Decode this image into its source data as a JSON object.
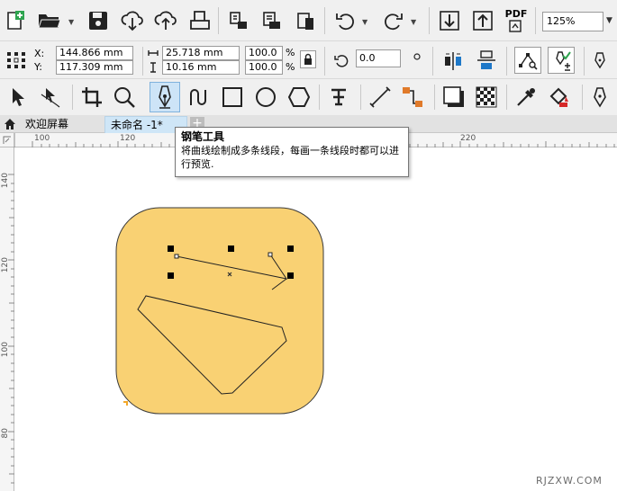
{
  "zoom": {
    "value": "125%"
  },
  "position": {
    "x_label": "X:",
    "y_label": "Y:",
    "x_value": "144.866 mm",
    "y_value": "117.309 mm"
  },
  "size": {
    "width_value": "25.718 mm",
    "height_value": "10.16 mm",
    "scale_x": "100.0",
    "scale_y": "100.0",
    "percent": "%"
  },
  "rotation": {
    "value": "0.0"
  },
  "pdf_label": "PDF",
  "tabs": {
    "welcome": "欢迎屏幕",
    "document": "未命名 -1*",
    "add": "+"
  },
  "ruler_h": {
    "labels": [
      "100",
      "120",
      "220"
    ]
  },
  "ruler_v": {
    "labels": [
      "140",
      "120",
      "100",
      "80"
    ]
  },
  "tooltip": {
    "title": "钢笔工具",
    "description": "将曲线绘制成多条线段，每画一条线段时都可以进行预览."
  },
  "colors": {
    "shape_fill": "#F9D173",
    "accent_blue": "#1e78c8",
    "pen_active_bg": "#cde4f7",
    "tab_active": "#cfe6f7",
    "new_doc_green": "#2ea44f"
  },
  "icons": [
    "new-document-icon",
    "open-folder-icon",
    "save-icon",
    "download-cloud-icon",
    "upload-cloud-icon",
    "print-icon",
    "import-icon",
    "export-icon",
    "clipboard-icon",
    "undo-icon",
    "redo-icon",
    "align-bottom-icon",
    "align-top-icon",
    "pdf-icon",
    "pick-tool-icon",
    "shape-tool-icon",
    "crop-tool-icon",
    "zoom-tool-icon",
    "pen-tool-icon",
    "freehand-tool-icon",
    "rectangle-tool-icon",
    "ellipse-tool-icon",
    "polygon-tool-icon",
    "text-tool-icon",
    "line-tool-icon",
    "connector-tool-icon",
    "drop-shadow-tool-icon",
    "transparency-tool-icon",
    "eyedropper-tool-icon",
    "fill-tool-icon",
    "home-icon",
    "lock-ratio-icon",
    "rotate-icon"
  ],
  "watermark": "RJZXW.COM"
}
